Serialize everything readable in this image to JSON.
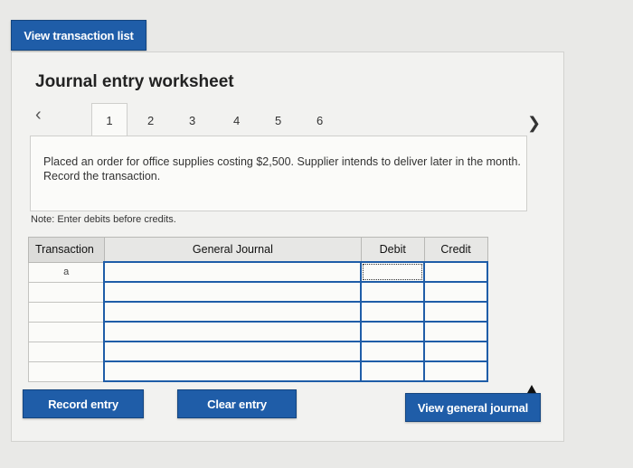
{
  "header": {
    "view_transaction_list": "View transaction list"
  },
  "worksheet": {
    "title": "Journal entry worksheet",
    "tabs": [
      "1",
      "2",
      "3",
      "4",
      "5",
      "6"
    ],
    "active_tab": "1",
    "description": "Placed an order for office supplies costing $2,500. Supplier intends to deliver later in the month. Record the transaction.",
    "note": "Note: Enter debits before credits."
  },
  "table": {
    "columns": {
      "transaction": "Transaction",
      "general_journal": "General Journal",
      "debit": "Debit",
      "credit": "Credit"
    },
    "rows": [
      {
        "transaction": "a",
        "general_journal": "",
        "debit": "",
        "credit": ""
      },
      {
        "transaction": "",
        "general_journal": "",
        "debit": "",
        "credit": ""
      },
      {
        "transaction": "",
        "general_journal": "",
        "debit": "",
        "credit": ""
      },
      {
        "transaction": "",
        "general_journal": "",
        "debit": "",
        "credit": ""
      },
      {
        "transaction": "",
        "general_journal": "",
        "debit": "",
        "credit": ""
      },
      {
        "transaction": "",
        "general_journal": "",
        "debit": "",
        "credit": ""
      }
    ]
  },
  "buttons": {
    "record_entry": "Record entry",
    "clear_entry": "Clear entry",
    "view_general_journal": "View general journal"
  },
  "colors": {
    "accent": "#1f5da8",
    "panel": "#f2f2f0"
  }
}
